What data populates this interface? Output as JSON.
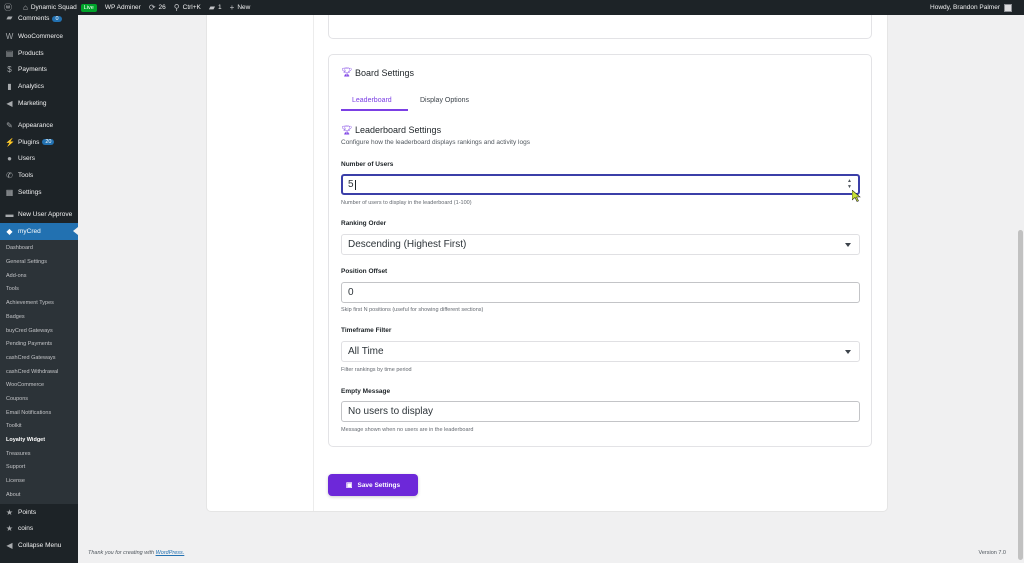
{
  "adminbar": {
    "site_name": "Dynamic Squad",
    "live_label": "Live",
    "adminer": "WP Adminer",
    "updates_count": "26",
    "shortcut": "Ctrl+K",
    "comments_count": "1",
    "new_label": "New",
    "howdy": "Howdy, Brandon Palmer"
  },
  "sidebar": {
    "top_items": [
      {
        "label": "Comments",
        "badge": "0"
      },
      {
        "label": "WooCommerce"
      },
      {
        "label": "Products"
      },
      {
        "label": "Payments"
      },
      {
        "label": "Analytics"
      },
      {
        "label": "Marketing"
      },
      {
        "label": "Appearance"
      },
      {
        "label": "Plugins",
        "badge": "20"
      },
      {
        "label": "Users"
      },
      {
        "label": "Tools"
      },
      {
        "label": "Settings"
      },
      {
        "label": "New User Approve"
      },
      {
        "label": "myCred"
      }
    ],
    "submenu": [
      "Dashboard",
      "General Settings",
      "Add-ons",
      "Tools",
      "Achievement Types",
      "Badges",
      "buyCred Gateways",
      "Pending Payments",
      "cashCred Gateways",
      "cashCred Withdrawal",
      "WooCommerce",
      "Coupons",
      "Email Notifications",
      "Toolkit",
      "Loyalty Widget",
      "Treasures",
      "Support",
      "License",
      "About"
    ],
    "bottom_items": [
      {
        "label": "Points"
      },
      {
        "label": "coins"
      },
      {
        "label": "Collapse Menu"
      }
    ]
  },
  "board": {
    "title": "Board Settings",
    "tabs": [
      "Leaderboard",
      "Display Options"
    ],
    "section_title": "Leaderboard Settings",
    "section_desc": "Configure how the leaderboard displays rankings and activity logs",
    "fields": {
      "users": {
        "label": "Number of Users",
        "value": "5",
        "help": "Number of users to display in the leaderboard (1-100)"
      },
      "order": {
        "label": "Ranking Order",
        "value": "Descending (Highest First)"
      },
      "offset": {
        "label": "Position Offset",
        "value": "0",
        "help": "Skip first N positions (useful for showing different sections)"
      },
      "timeframe": {
        "label": "Timeframe Filter",
        "value": "All Time",
        "help": "Filter rankings by time period"
      },
      "empty": {
        "label": "Empty Message",
        "value": "No users to display",
        "help": "Message shown when no users are in the leaderboard"
      }
    },
    "save_label": "Save Settings"
  },
  "footer": {
    "thanks": "Thank you for creating with",
    "wp_link": "WordPress.",
    "version": "Version 7.0"
  },
  "colors": {
    "accent": "#6d28d9",
    "wp_blue": "#2271b1",
    "admin_dark": "#1d2327"
  }
}
